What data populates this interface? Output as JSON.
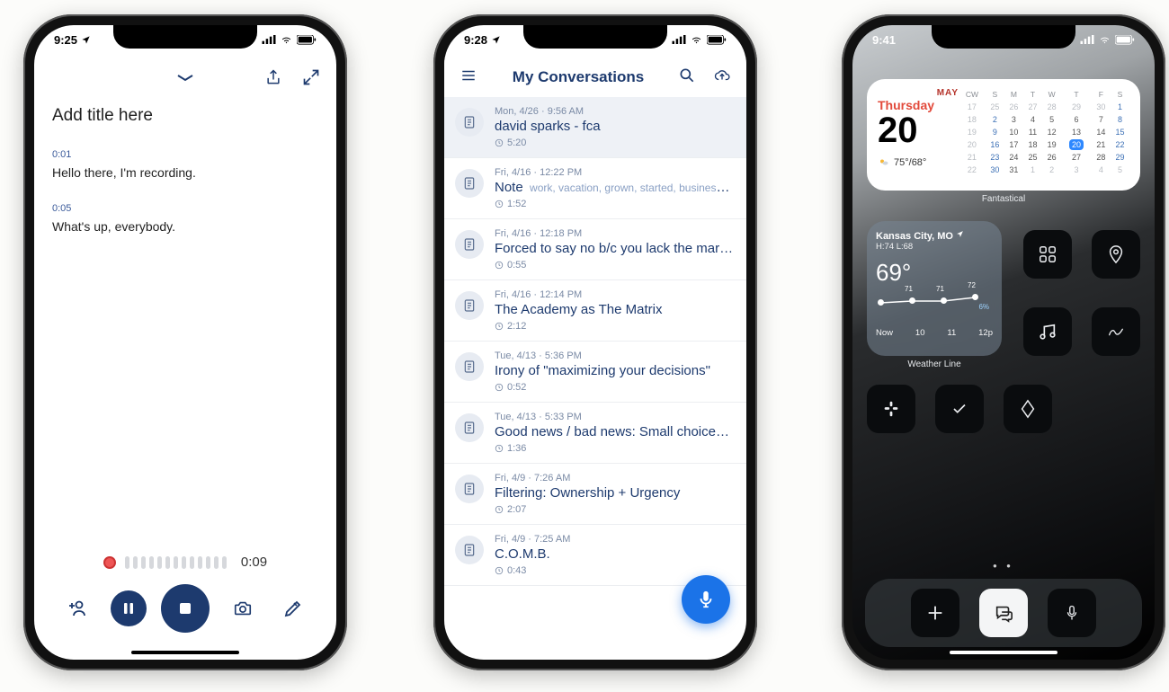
{
  "phone1": {
    "status_time": "9:25",
    "title_placeholder": "Add title here",
    "segments": [
      {
        "ts": "0:01",
        "text": "Hello there, I'm recording."
      },
      {
        "ts": "0:05",
        "text": "What's up, everybody."
      }
    ],
    "elapsed": "0:09"
  },
  "phone2": {
    "status_time": "9:28",
    "header_title": "My Conversations",
    "rows": [
      {
        "date": "Mon, 4/26 · 9:56 AM",
        "title": "david sparks - fca",
        "tags": "",
        "dur": "5:20",
        "selected": true
      },
      {
        "date": "Fri, 4/16 · 12:22 PM",
        "title": "Note",
        "tags": "work, vacation, grown, started, business,…",
        "dur": "1:52",
        "selected": false
      },
      {
        "date": "Fri, 4/16 · 12:18 PM",
        "title": "Forced to say no b/c you lack the margi…",
        "tags": "",
        "dur": "0:55",
        "selected": false
      },
      {
        "date": "Fri, 4/16 · 12:14 PM",
        "title": "The Academy as The Matrix",
        "tags": "",
        "dur": "2:12",
        "selected": false
      },
      {
        "date": "Tue, 4/13 · 5:36 PM",
        "title": "Irony of \"maximizing your decisions\"",
        "tags": "",
        "dur": "0:52",
        "selected": false
      },
      {
        "date": "Tue, 4/13 · 5:33 PM",
        "title": "Good news / bad news: Small choices d…",
        "tags": "",
        "dur": "1:36",
        "selected": false
      },
      {
        "date": "Fri, 4/9 · 7:26 AM",
        "title": "Filtering: Ownership + Urgency",
        "tags": "",
        "dur": "2:07",
        "selected": false
      },
      {
        "date": "Fri, 4/9 · 7:25 AM",
        "title": "C.O.M.B.",
        "tags": "",
        "dur": "0:43",
        "selected": false
      }
    ]
  },
  "phone3": {
    "status_time": "9:41",
    "calendar": {
      "month": "MAY",
      "day_of_week": "Thursday",
      "day_num": "20",
      "temp": "75°/68°",
      "headers": [
        "CW",
        "S",
        "M",
        "T",
        "W",
        "T",
        "F",
        "S"
      ],
      "rows": [
        [
          "17",
          "25",
          "26",
          "27",
          "28",
          "29",
          "30",
          "1"
        ],
        [
          "18",
          "2",
          "3",
          "4",
          "5",
          "6",
          "7",
          "8"
        ],
        [
          "19",
          "9",
          "10",
          "11",
          "12",
          "13",
          "14",
          "15"
        ],
        [
          "20",
          "16",
          "17",
          "18",
          "19",
          "20",
          "21",
          "22"
        ],
        [
          "21",
          "23",
          "24",
          "25",
          "26",
          "27",
          "28",
          "29"
        ],
        [
          "22",
          "30",
          "31",
          "1",
          "2",
          "3",
          "4",
          "5"
        ]
      ],
      "widget_label": "Fantastical"
    },
    "weather": {
      "location": "Kansas City, MO",
      "hi_lo": "H:74 L:68",
      "temp": "69°",
      "spark": [
        "71",
        "71",
        "72"
      ],
      "precip": "6%",
      "hours": [
        "Now",
        "10",
        "11",
        "12p"
      ],
      "widget_label": "Weather Line"
    }
  }
}
